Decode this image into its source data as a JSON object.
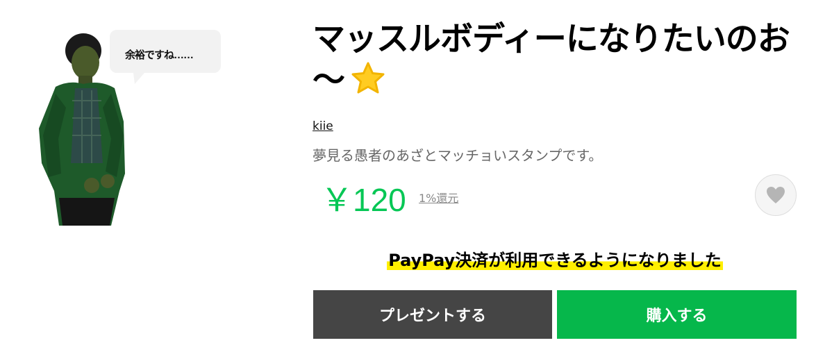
{
  "sticker": {
    "bubble_text": "余裕ですね……"
  },
  "product": {
    "title": "マッスルボディーになりたいのお～",
    "title_emoji_icon": "star-icon",
    "author": "kiie",
    "description": "夢見る愚者のあざとマッチョいスタンプです。",
    "price": "￥120",
    "reward": "1%還元"
  },
  "favorite": {
    "icon": "heart-icon"
  },
  "banner": {
    "text": "PayPay決済が利用できるようになりました"
  },
  "buttons": {
    "present": "プレゼントする",
    "buy": "購入する"
  },
  "colors": {
    "price_green": "#06c755",
    "buy_green": "#06b74b",
    "present_gray": "#454545",
    "highlight_yellow": "#ffef00"
  }
}
